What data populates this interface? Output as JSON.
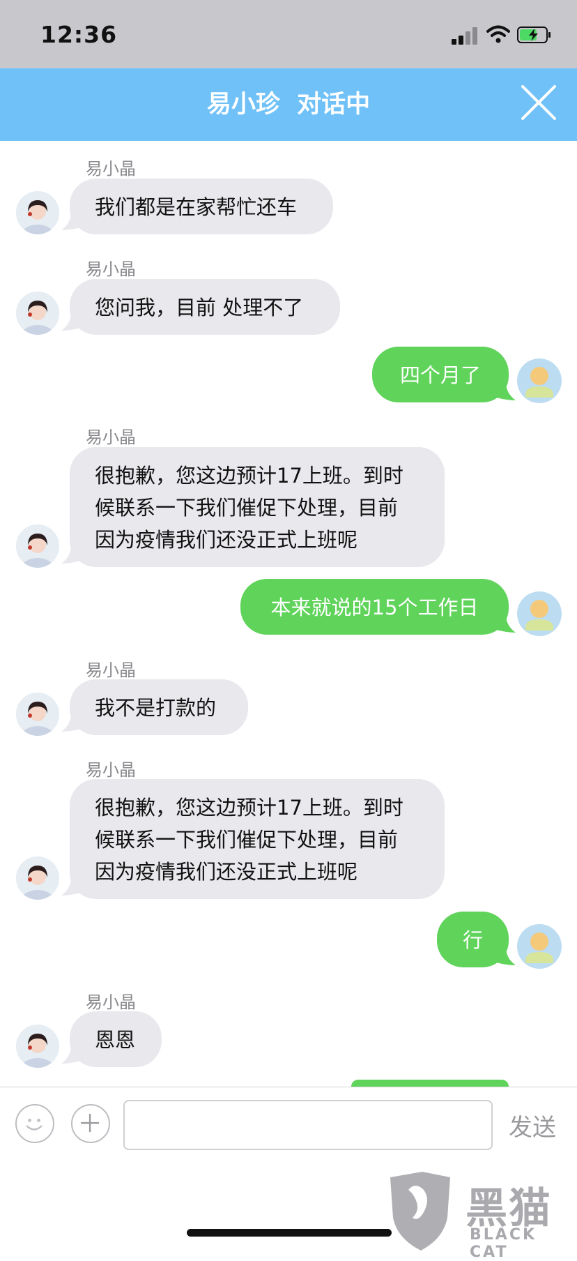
{
  "status_bar": {
    "time": "12:36"
  },
  "header": {
    "title": "易小珍  对话中"
  },
  "messages": [
    {
      "side": "left",
      "sender": "易小晶",
      "lines": [
        "我们都是在家帮忙还车"
      ]
    },
    {
      "side": "left",
      "sender": "易小晶",
      "lines": [
        "您问我，目前 处理不了"
      ]
    },
    {
      "side": "right",
      "lines": [
        "四个月了"
      ]
    },
    {
      "side": "left",
      "sender": "易小晶",
      "lines": [
        "很抱歉，您这边预计17上班。到时",
        "候联系一下我们催促下处理，目前",
        "因为疫情我们还没正式上班呢"
      ]
    },
    {
      "side": "right",
      "lines": [
        "本来就说的15个工作日"
      ]
    },
    {
      "side": "left",
      "sender": "易小晶",
      "lines": [
        "我不是打款的"
      ]
    },
    {
      "side": "left",
      "sender": "易小晶",
      "lines": [
        "很抱歉，您这边预计17上班。到时",
        "候联系一下我们催促下处理，目前",
        "因为疫情我们还没正式上班呢"
      ]
    },
    {
      "side": "right",
      "lines": [
        "行"
      ]
    },
    {
      "side": "left",
      "sender": "易小晶",
      "lines": [
        "恩恩"
      ]
    }
  ],
  "input_bar": {
    "message_value": "",
    "send_label": "发送"
  },
  "watermark": {
    "cn": "黑猫",
    "en": "BLACK CAT"
  },
  "colors": {
    "header": "#6fc1f7",
    "bubble_left": "#e8e8ed",
    "bubble_right": "#5fd35a"
  }
}
